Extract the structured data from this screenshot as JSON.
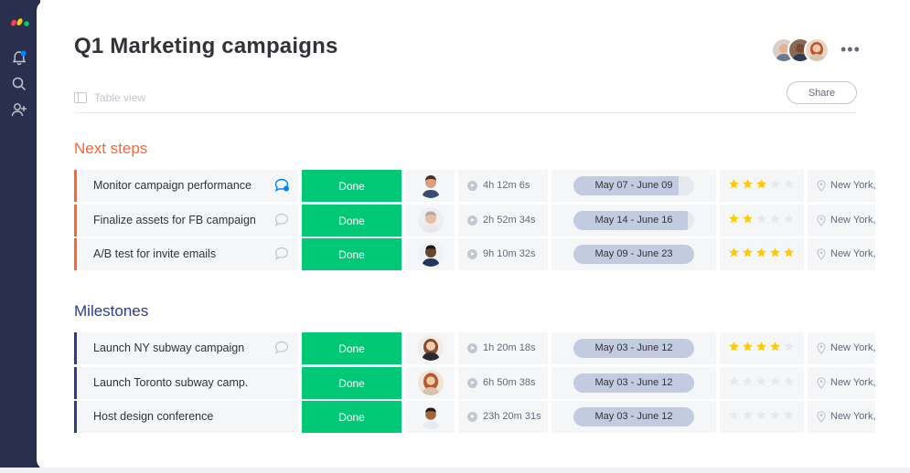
{
  "page": {
    "title": "Q1 Marketing campaigns",
    "view_label": "Table view",
    "share_label": "Share",
    "more_label": "•••"
  },
  "colors": {
    "done": "#00c875",
    "next_steps": "#ff642e",
    "milestones": "#2e3a8c",
    "star_on": "#ffcb00",
    "star_off": "#e6e9ef"
  },
  "groups": [
    {
      "title": "Next steps",
      "rows": [
        {
          "name": "Monitor campaign performance",
          "status": "Done",
          "time": "4h 12m 6s",
          "dates": "May 07 - June 09",
          "date_progress": 0.87,
          "rating": 3,
          "location": "New York,",
          "has_update": true
        },
        {
          "name": "Finalize assets for FB campaign",
          "status": "Done",
          "time": "2h 52m 34s",
          "dates": "May 14 - June 16",
          "date_progress": 0.95,
          "rating": 2,
          "location": "New York,",
          "has_update": false
        },
        {
          "name": "A/B test for invite emails",
          "status": "Done",
          "time": "9h 10m 32s",
          "dates": "May 09 - June 23",
          "date_progress": 1.0,
          "rating": 5,
          "location": "New York,",
          "has_update": false
        }
      ]
    },
    {
      "title": "Milestones",
      "rows": [
        {
          "name": "Launch NY subway campaign",
          "status": "Done",
          "time": "1h 20m 18s",
          "dates": "May 03 - June 12",
          "date_progress": 1.0,
          "rating": 4,
          "location": "New York,",
          "has_update": false
        },
        {
          "name": "Launch Toronto subway camp.",
          "status": "Done",
          "time": "6h 50m 38s",
          "dates": "May 03 - June 12",
          "date_progress": 1.0,
          "rating": 0,
          "location": "New York,",
          "has_update": false
        },
        {
          "name": "Host design conference",
          "status": "Done",
          "time": "23h 20m 31s",
          "dates": "May 03 - June 12",
          "date_progress": 1.0,
          "rating": 0,
          "location": "New York,",
          "has_update": false
        }
      ]
    }
  ],
  "icons": {
    "rail": [
      "bell-icon",
      "search-icon",
      "add-user-icon"
    ],
    "view": "table-icon",
    "timer": "play-icon",
    "location": "pin-icon",
    "update": "chat-bubble-icon"
  }
}
